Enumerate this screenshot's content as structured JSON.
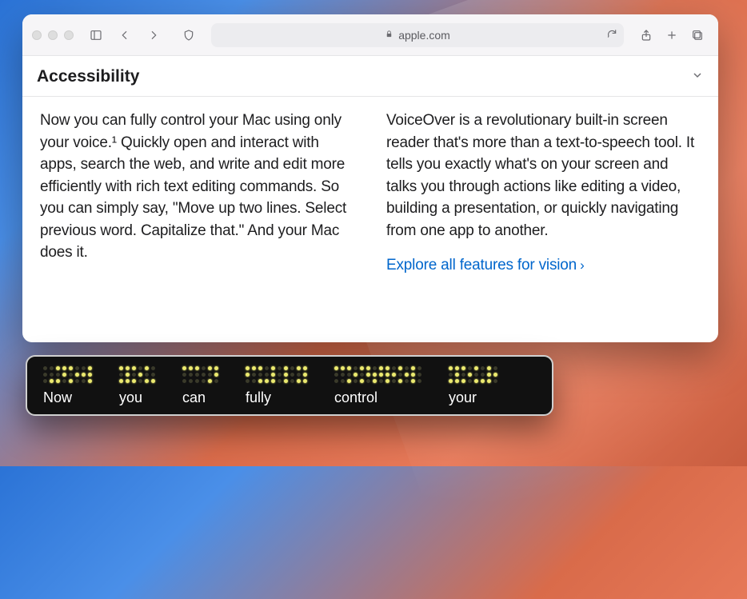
{
  "address_bar": {
    "domain": "apple.com"
  },
  "page": {
    "section_title": "Accessibility",
    "col1": "Now you can fully control your Mac using only your voice.¹ Quickly open and interact with apps, search the web, and write and edit more efficiently with rich text editing commands. So you can simply say, \"Move up two lines. Select previous word. Capitalize that.\" And your Mac does it.",
    "col2": "VoiceOver is a revolutionary built-in screen reader that's more than a text-to-speech tool. It tells you exactly what's on your screen and talks you through actions like editing a video, building a presentation, or quickly navigating from one app to another.",
    "link_text": "Explore all features for vision"
  },
  "braille": {
    "words": [
      "Now",
      "you",
      "can",
      "fully",
      "control",
      "your"
    ]
  }
}
